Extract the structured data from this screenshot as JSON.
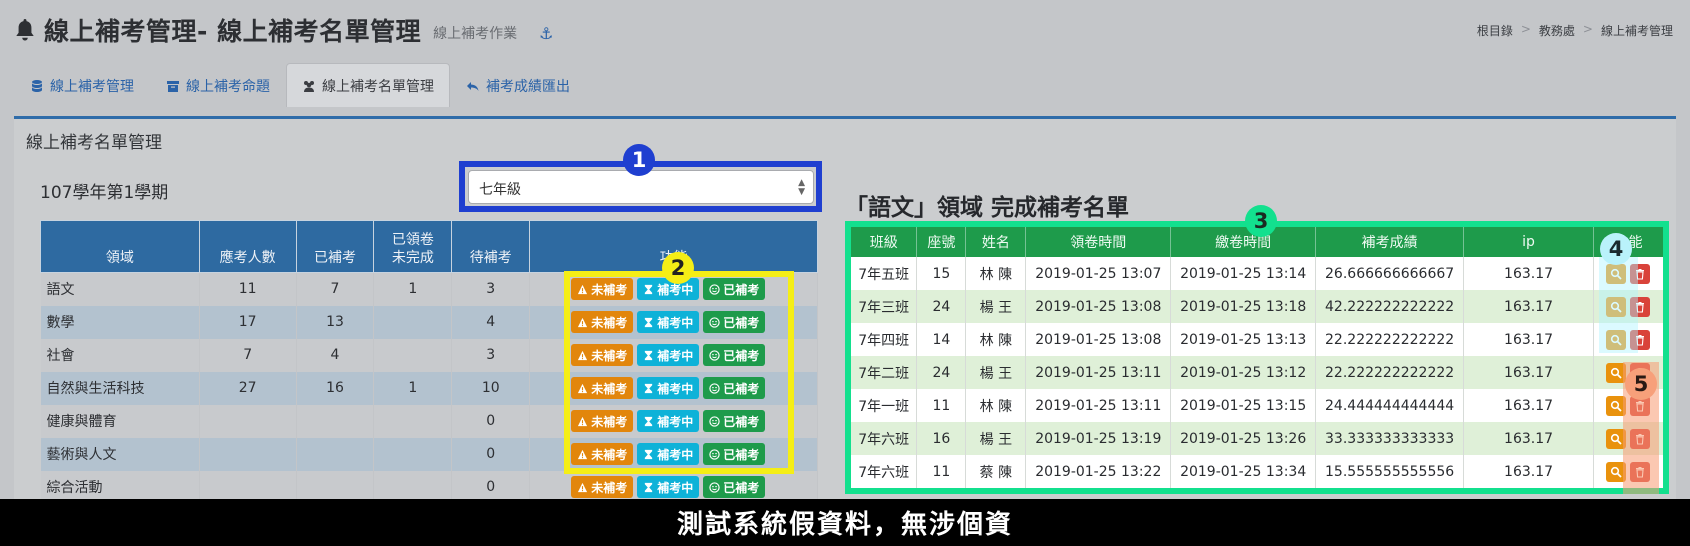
{
  "header": {
    "title": "線上補考管理- 線上補考名單管理",
    "subtitle": "線上補考作業",
    "breadcrumb": [
      "根目錄",
      "教務處",
      "線上補考管理"
    ]
  },
  "tabs": [
    {
      "label": "線上補考管理",
      "icon": "database-icon"
    },
    {
      "label": "線上補考命題",
      "icon": "archive-icon"
    },
    {
      "label": "線上補考名單管理",
      "icon": "users-icon",
      "active": true
    },
    {
      "label": "補考成績匯出",
      "icon": "reply-icon"
    }
  ],
  "panel": {
    "title": "線上補考名單管理",
    "term": "107學年第1學期",
    "grade_select": "七年級"
  },
  "left_table": {
    "headers": [
      "領域",
      "應考人數",
      "已補考",
      "已領卷\n未完成",
      "待補考",
      "功能"
    ],
    "rows": [
      [
        "語文",
        "11",
        "7",
        "1",
        "3"
      ],
      [
        "數學",
        "17",
        "13",
        "",
        "4"
      ],
      [
        "社會",
        "7",
        "4",
        "",
        "3"
      ],
      [
        "自然與生活科技",
        "27",
        "16",
        "1",
        "10"
      ],
      [
        "健康與體育",
        "",
        "",
        "",
        "0"
      ],
      [
        "藝術與人文",
        "",
        "",
        "",
        "0"
      ],
      [
        "綜合活動",
        "",
        "",
        "",
        "0"
      ]
    ],
    "buttons": {
      "not_taken": "未補考",
      "in_progress": "補考中",
      "done": "已補考"
    }
  },
  "right_title": "「語文」領域 完成補考名單",
  "right_table": {
    "headers": [
      "班級",
      "座號",
      "姓名",
      "領卷時間",
      "繳卷時間",
      "補考成績",
      "ip",
      "功能"
    ],
    "rows": [
      [
        "7年五班",
        "15",
        "林 陳",
        "2019-01-25 13:07",
        "2019-01-25 13:14",
        "26.666666666667",
        "163.17"
      ],
      [
        "7年三班",
        "24",
        "楊 王",
        "2019-01-25 13:08",
        "2019-01-25 13:18",
        "42.222222222222",
        "163.17"
      ],
      [
        "7年四班",
        "14",
        "林 陳",
        "2019-01-25 13:08",
        "2019-01-25 13:13",
        "22.222222222222",
        "163.17"
      ],
      [
        "7年二班",
        "24",
        "楊 王",
        "2019-01-25 13:11",
        "2019-01-25 13:12",
        "22.222222222222",
        "163.17"
      ],
      [
        "7年一班",
        "11",
        "林 陳",
        "2019-01-25 13:11",
        "2019-01-25 13:15",
        "24.444444444444",
        "163.17"
      ],
      [
        "7年六班",
        "16",
        "楊 王",
        "2019-01-25 13:19",
        "2019-01-25 13:26",
        "33.333333333333",
        "163.17"
      ],
      [
        "7年六班",
        "11",
        "蔡 陳",
        "2019-01-25 13:22",
        "2019-01-25 13:34",
        "15.555555555556",
        "163.17"
      ]
    ]
  },
  "annotations": [
    "1",
    "2",
    "3",
    "4",
    "5"
  ],
  "caption": "測試系統假資料，無涉個資",
  "colors": {
    "primary_blue": "#2e6aa1",
    "green": "#1e9b4b",
    "orange": "#e2860c",
    "cyan": "#0eb2d8",
    "annotation_blue": "#1f3fd0",
    "annotation_yellow": "#f5ee16",
    "annotation_green": "#13e08e"
  }
}
